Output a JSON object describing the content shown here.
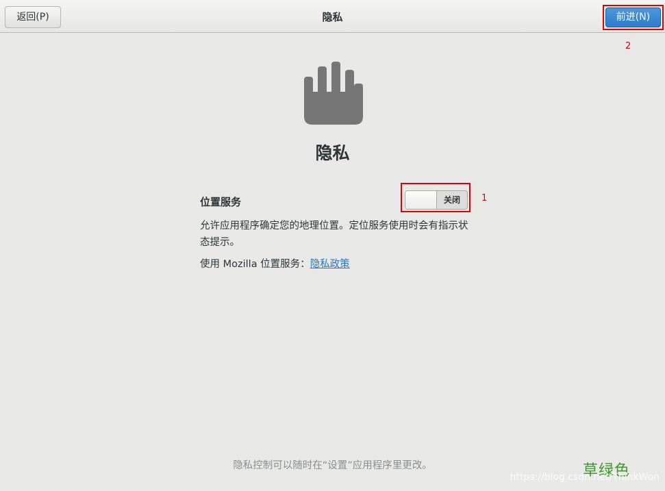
{
  "header": {
    "title": "隐私",
    "back_label": "返回(P)",
    "next_label": "前进(N)"
  },
  "markers": {
    "next": "2",
    "switch": "1"
  },
  "main": {
    "icon": "hand-stop-icon",
    "heading": "隐私",
    "location": {
      "label": "位置服务",
      "switch_state": "关闭",
      "description": "允许应用程序确定您的地理位置。定位服务使用时会有指示状态提示。",
      "mozilla_prefix": "使用 Mozilla 位置服务：",
      "policy_link": "隐私政策"
    },
    "footer_note": "隐私控制可以随时在“设置”应用程序里更改。"
  },
  "watermark": {
    "cn": "草绿色",
    "url": "https://blog.csdn.net/ThinkWon"
  },
  "colors": {
    "accent": "#3584e4",
    "highlight_box": "#e00000",
    "link": "#2a76c6"
  }
}
